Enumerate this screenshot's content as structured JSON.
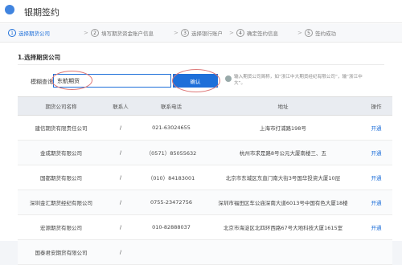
{
  "title": "银期签约",
  "steps": [
    {
      "num": "1",
      "label": "选择期货公司"
    },
    {
      "num": "2",
      "label": "填写期货资金账户信息"
    },
    {
      "num": "3",
      "label": "选择银行账户"
    },
    {
      "num": "4",
      "label": "确定签约信息"
    },
    {
      "num": "5",
      "label": "签约成功"
    }
  ],
  "section_title": "1.选择期货公司",
  "search": {
    "label": "模糊查询：",
    "value": "东航期货",
    "button": "确认",
    "tip": "输入期货公司简称，如“浙江中大期货经纪有限公司”，输“浙江中大”。"
  },
  "table": {
    "headers": [
      "期货公司名称",
      "联系人",
      "联系电话",
      "地址",
      "操作"
    ],
    "rows": [
      [
        "建信期货有限责任公司",
        "/",
        "021-63024655",
        "上海市打浦路198号",
        "开通"
      ],
      [
        "金成期货有限公司",
        "/",
        "（0571）85055632",
        "杭州市求是路8号公元大厦南楼三、五",
        "开通"
      ],
      [
        "国都期货有限公司",
        "/",
        "（010）84183001",
        "北京市东城区东直门南大街3号国华投资大厦10层",
        "开通"
      ],
      [
        "深圳金汇期货经纪有限公司",
        "/",
        "0755-23472756",
        "深圳市福田区车公庙深南大道6013号中国有色大厦18楼",
        "开通"
      ],
      [
        "宏源期货有限公司",
        "/",
        "010-82888037",
        "北京市海淀区北四环西路67号大地科技大厦1615室",
        "开通"
      ],
      [
        "国泰君安期货有限公司",
        "/",
        "",
        "",
        ""
      ]
    ]
  }
}
